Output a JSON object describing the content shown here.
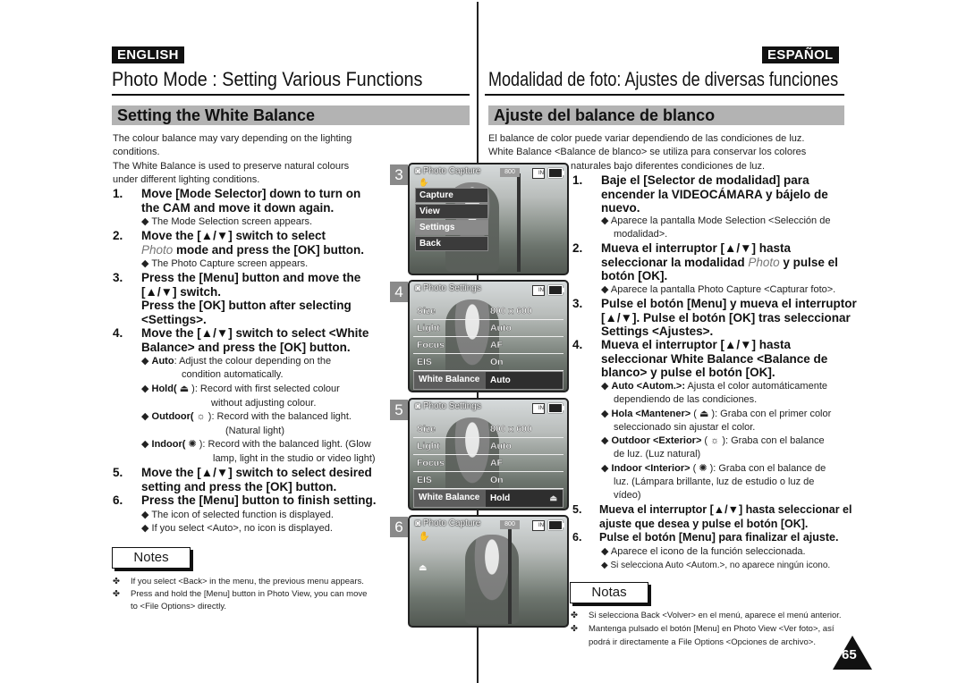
{
  "languages": {
    "english": "ENGLISH",
    "spanish": "ESPAÑOL"
  },
  "titles": {
    "en": "Photo Mode : Setting Various Functions",
    "es": "Modalidad de foto: Ajustes de diversas funciones"
  },
  "sections": {
    "en": "Setting the White Balance",
    "es": "Ajuste del balance de blanco"
  },
  "en": {
    "intro": [
      "The colour balance may vary depending on the lighting",
      "conditions.",
      "The White Balance is used to preserve natural colours",
      "under different lighting conditions."
    ],
    "steps": [
      {
        "num": "1.",
        "lines": [
          "Move [Mode Selector] down to turn on",
          "the CAM and move it down again."
        ],
        "sub": [
          "◆ The Mode Selection screen appears."
        ]
      },
      {
        "num": "2.",
        "lines": [
          "Move the [▲/▼] switch to select",
          "mode and press the [OK] button."
        ],
        "italic": "Photo",
        "sub": [
          "◆ The Photo Capture screen appears."
        ]
      },
      {
        "num": "3.",
        "lines": [
          "Press the [Menu] button and move the",
          "[▲/▼] switch.",
          "Press the [OK] button after selecting",
          "<Settings>."
        ]
      },
      {
        "num": "4.",
        "lines": [
          "Move the [▲/▼] switch to select <White",
          "Balance> and press the [OK] button."
        ]
      },
      {
        "num": "5.",
        "lines": [
          "Move the [▲/▼] switch to select desired",
          "setting and press the [OK] button."
        ]
      },
      {
        "num": "6.",
        "lines": [
          "Press the [Menu] button to finish setting."
        ],
        "sub": [
          "◆ The icon of selected function is displayed.",
          "◆ If you select <Auto>, no icon is displayed."
        ]
      }
    ],
    "options": [
      {
        "label": "Auto",
        "icon": "",
        "desc": ": Adjust the colour depending on the",
        "desc2": "condition automatically."
      },
      {
        "label": "Hold(",
        "icon": "⛾",
        "desc": "): Record with first selected colour",
        "desc2": "without adjusting colour."
      },
      {
        "label": "Outdoor(",
        "icon": "☼",
        "desc": "):  Record with the balanced light.",
        "desc2": "(Natural light)"
      },
      {
        "label": "Indoor(",
        "icon": "💡",
        "desc": "): Record with the balanced light. (Glow",
        "desc2": "lamp, light in the studio or video light)"
      }
    ],
    "notes_label": "Notes",
    "notes": [
      "If you select <Back> in the menu, the previous menu appears.",
      "Press and hold the [Menu] button in Photo View, you can move",
      "to <File Options> directly."
    ]
  },
  "es": {
    "intro": [
      "El balance de color puede variar dependiendo de las condiciones de luz.",
      "White Balance <Balance de blanco> se utiliza para conservar los colores",
      "naturales bajo diferentes condiciones de luz."
    ],
    "steps": [
      {
        "num": "1.",
        "lines": [
          "Baje el [Selector de modalidad] para",
          "encender la VIDEOCÁMARA y bájelo de",
          "nuevo."
        ],
        "sub": [
          "◆  Aparece la pantalla Mode Selection <Selección de",
          "modalidad>."
        ]
      },
      {
        "num": "2.",
        "lines": [
          "Mueva el interruptor [▲/▼] hasta",
          "seleccionar la modalidad",
          "y pulse el",
          "botón [OK]."
        ],
        "italic": "Photo",
        "sub": [
          "◆  Aparece la pantalla Photo Capture <Capturar foto>."
        ]
      },
      {
        "num": "3.",
        "lines": [
          "Pulse el botón [Menu] y mueva el interruptor",
          "[▲/▼]. Pulse el botón [OK] tras seleccionar",
          "Settings <Ajustes>."
        ]
      },
      {
        "num": "4.",
        "lines": [
          "Mueva el interruptor [▲/▼] hasta",
          "seleccionar White Balance <Balance de",
          "blanco> y pulse el botón [OK]."
        ]
      },
      {
        "num": "5.",
        "lines": [
          "Mueva el interruptor [▲/▼] hasta seleccionar el",
          "ajuste que desea y pulse el botón [OK]."
        ]
      },
      {
        "num": "6.",
        "lines": [
          "Pulse el botón [Menu] para finalizar el ajuste."
        ],
        "sub": [
          "◆  Aparece el icono de la función seleccionada.",
          "◆  Si selecciona Auto <Autom.>, no aparece ningún icono."
        ]
      }
    ],
    "options": [
      {
        "label": "Auto <Autom.>:",
        "desc": " Ajusta el color automáticamente",
        "desc2": "dependiendo de las condiciones."
      },
      {
        "label": "Hola <Mantener>",
        "icon": "⛾",
        "desc": "): Graba con el primer color",
        "desc2": "seleccionado sin ajustar el color."
      },
      {
        "label": "Outdoor <Exterior>",
        "icon": "☼",
        "desc": "): Graba con el balance",
        "desc2": "de luz. (Luz natural)"
      },
      {
        "label": "Indoor <Interior>",
        "icon": "💡",
        "desc": "): Graba con el balance de",
        "desc2": "luz. (Lámpara brillante, luz de estudio o luz de",
        "desc3": "vídeo)"
      }
    ],
    "notes_label": "Notas",
    "notes": [
      "Si selecciona Back <Volver> en el menú, aparece el menú anterior.",
      "Mantenga pulsado el botón [Menu] en Photo View <Ver foto>, así",
      "podrá ir directamente a File Options <Opciones de archivo>."
    ]
  },
  "screens": [
    {
      "step": "3",
      "title": "Photo Capture",
      "resolution_badge": "800",
      "menu": [
        "Capture",
        "View",
        "Settings",
        "Back"
      ],
      "selected": "Settings"
    },
    {
      "step": "4",
      "title": "Photo Settings",
      "rows": [
        [
          "Size",
          "800 x 600"
        ],
        [
          "Light",
          "Auto"
        ],
        [
          "Focus",
          "AF"
        ],
        [
          "EIS",
          "On"
        ]
      ],
      "wb_label": "White Balance",
      "wb_value": "Auto"
    },
    {
      "step": "5",
      "title": "Photo Settings",
      "rows": [
        [
          "Size",
          "800 x 600"
        ],
        [
          "Light",
          "Auto"
        ],
        [
          "Focus",
          "AF"
        ],
        [
          "EIS",
          "On"
        ]
      ],
      "wb_label": "White Balance",
      "wb_value": "Hold"
    },
    {
      "step": "6",
      "title": "Photo Capture",
      "resolution_badge": "800"
    }
  ],
  "page_number": "65",
  "bullet": "✤"
}
